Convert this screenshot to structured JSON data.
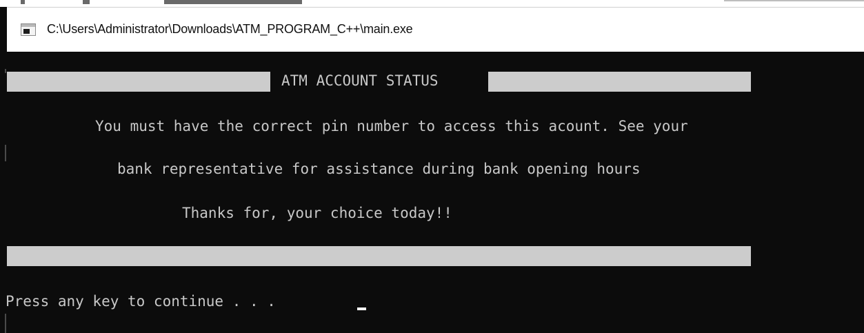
{
  "window": {
    "title": "C:\\Users\\Administrator\\Downloads\\ATM_PROGRAM_C++\\main.exe",
    "icon": "console-app-icon"
  },
  "console": {
    "header": "ATM ACCOUNT STATUS",
    "message_line_1": "You must have the correct pin number to access this acount. See your",
    "message_line_2": "bank representative for assistance during bank opening hours",
    "thanks": "Thanks for, your choice today!!",
    "prompt": "Press any key to continue . . .",
    "colors": {
      "background": "#0c0c0c",
      "text": "#c8c8c8",
      "highlight_bar": "#cccccc",
      "cursor": "#ffffff"
    }
  }
}
